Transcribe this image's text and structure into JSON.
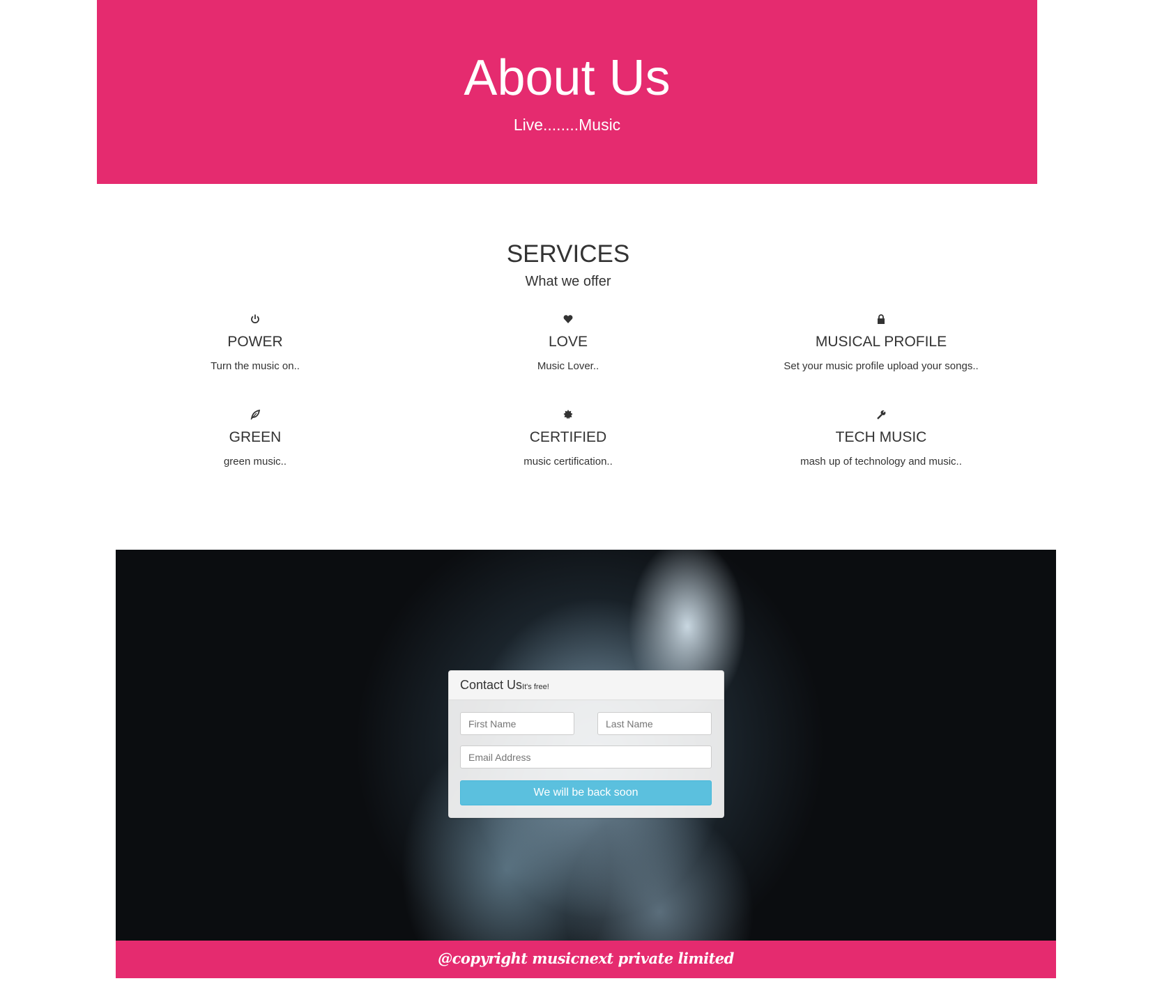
{
  "hero": {
    "title": "About Us",
    "subtitle": "Live........Music"
  },
  "services": {
    "title": "SERVICES",
    "subtitle": "What we offer",
    "items": [
      {
        "icon": "power-icon",
        "title": "POWER",
        "desc": "Turn the music on.."
      },
      {
        "icon": "heart-icon",
        "title": "LOVE",
        "desc": "Music Lover.."
      },
      {
        "icon": "lock-icon",
        "title": "MUSICAL PROFILE",
        "desc": "Set your music profile upload your songs.."
      },
      {
        "icon": "leaf-icon",
        "title": "GREEN",
        "desc": "green music.."
      },
      {
        "icon": "certificate-icon",
        "title": "CERTIFIED",
        "desc": "music certification.."
      },
      {
        "icon": "wrench-icon",
        "title": "TECH MUSIC",
        "desc": "mash up of technology and music.."
      }
    ]
  },
  "contact": {
    "title": "Contact Us",
    "tagline": "It's free!",
    "first_name_placeholder": "First Name",
    "last_name_placeholder": "Last Name",
    "email_placeholder": "Email Address",
    "button_label": "We will be back soon"
  },
  "footer": {
    "text": "@copyright musicnext private limited"
  },
  "colors": {
    "brand": "#e52b6f",
    "button": "#5bc0de"
  }
}
